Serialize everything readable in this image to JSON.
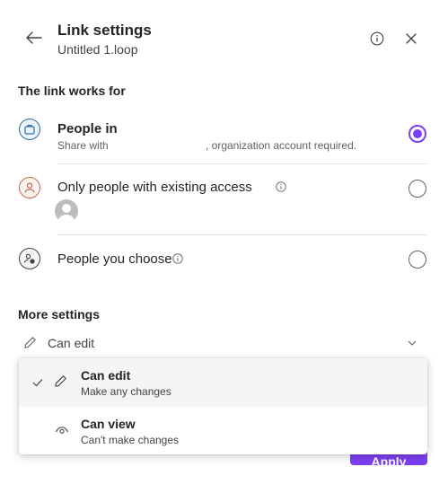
{
  "header": {
    "title": "Link settings",
    "subtitle": "Untitled 1.loop",
    "back_icon": "arrow-left-icon",
    "info_icon": "info-icon",
    "close_icon": "close-icon"
  },
  "link_works_for": {
    "heading": "The link works for",
    "options": [
      {
        "title": "People in",
        "description_left": "Share with ",
        "description_right": ", organization account required.",
        "icon": "building-icon",
        "selected": true
      },
      {
        "title": "Only people with existing access",
        "icon": "person-icon",
        "selected": false
      },
      {
        "title": "People you choose",
        "icon": "people-settings-icon",
        "selected": false
      }
    ]
  },
  "more_settings": {
    "heading": "More settings",
    "permission_value": "Can edit",
    "menu": [
      {
        "title": "Can edit",
        "description": "Make any changes",
        "selected": true,
        "icon": "pencil-icon"
      },
      {
        "title": "Can view",
        "description": "Can't make changes",
        "selected": false,
        "icon": "eye-icon"
      }
    ]
  },
  "apply_label": "Apply",
  "colors": {
    "accent": "#7b3ff2",
    "option1_icon": "#2b6cb0",
    "option2_icon": "#c06b52"
  }
}
